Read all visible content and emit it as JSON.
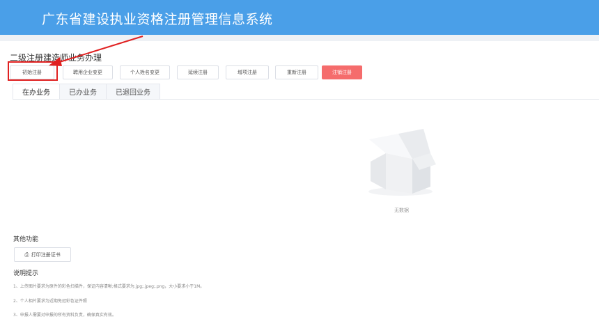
{
  "header": {
    "title": "广东省建设执业资格注册管理信息系统"
  },
  "section": {
    "title": "二级注册建造师业务办理"
  },
  "actions": [
    {
      "label": "初始注册"
    },
    {
      "label": "聘用企业变更"
    },
    {
      "label": "个人姓名变更"
    },
    {
      "label": "延续注册"
    },
    {
      "label": "增项注册"
    },
    {
      "label": "重新注册"
    },
    {
      "label": "注销注册"
    }
  ],
  "tabs": [
    {
      "label": "在办业务"
    },
    {
      "label": "已办业务"
    },
    {
      "label": "已退回业务"
    }
  ],
  "empty": {
    "text": "无数据"
  },
  "other": {
    "title": "其他功能",
    "print_label": "打印注册证书"
  },
  "notes": {
    "title": "说明提示",
    "items": [
      "1、上传图片要求为原件的彩色扫描件，保证内容清晰;格式要求为.jpg;.jpeg;.png，大小要求小于1M。",
      "2、个人相片要求为近期免冠彩色证件照",
      "3、申报人需要对申报的所有资料负责，确保真实有效。"
    ]
  },
  "colors": {
    "header": "#4a9fe8",
    "danger": "#f56c6c",
    "annotation": "#e02020"
  },
  "icons": {
    "print": "printer-icon",
    "empty": "empty-box-icon"
  }
}
